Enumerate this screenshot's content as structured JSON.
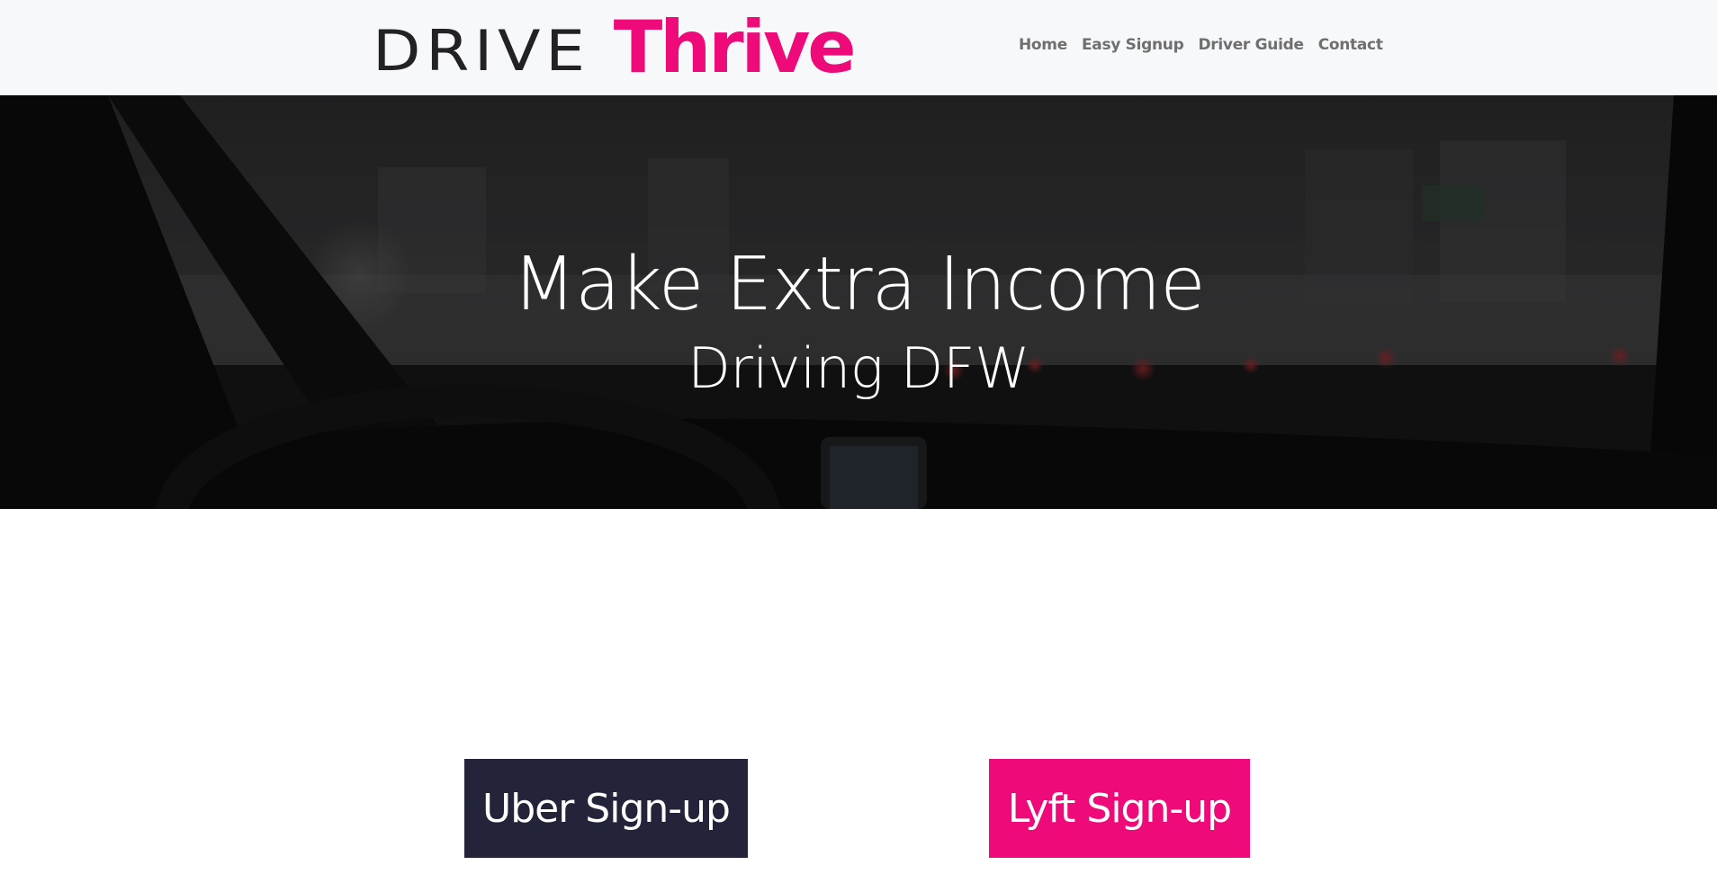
{
  "logo": {
    "drive_text": "DRIVE",
    "thrive_text": "Thrive",
    "drive_color": "#222226",
    "thrive_color": "#ee0a78"
  },
  "nav": {
    "items": [
      {
        "label": "Home"
      },
      {
        "label": "Easy Signup"
      },
      {
        "label": "Driver Guide"
      },
      {
        "label": "Contact"
      }
    ]
  },
  "hero": {
    "title": "Make Extra Income",
    "subtitle": "Driving DFW",
    "overlay_color": "#1b1b1d"
  },
  "buttons": {
    "uber": {
      "label": "Uber Sign-up",
      "color": "#23233a"
    },
    "lyft": {
      "label": "Lyft Sign-up",
      "color": "#ee0a78"
    }
  }
}
